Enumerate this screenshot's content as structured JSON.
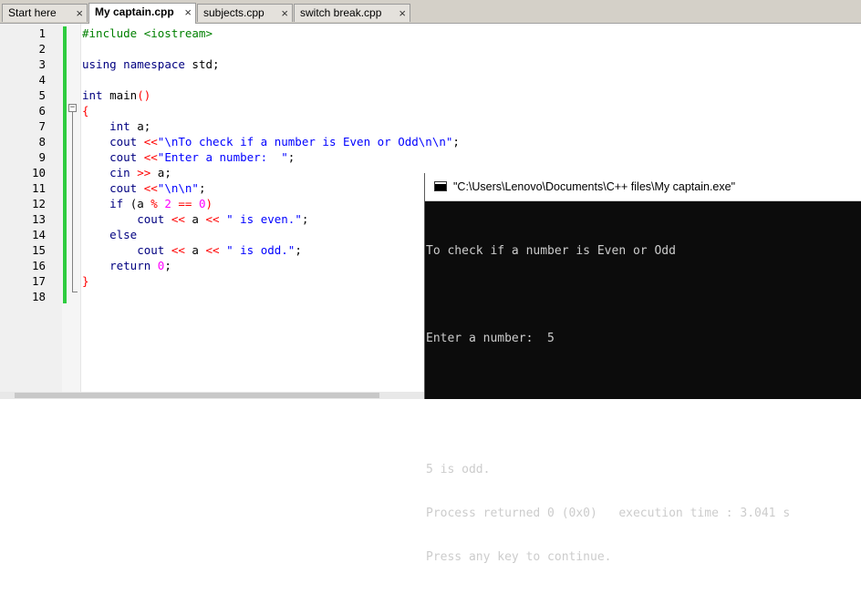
{
  "tabs": [
    {
      "label": "Start here",
      "close": "×"
    },
    {
      "label": "My captain.cpp",
      "close": "×",
      "active": true
    },
    {
      "label": "subjects.cpp",
      "close": "×"
    },
    {
      "label": "switch break.cpp",
      "close": "×"
    }
  ],
  "editor": {
    "line_numbers": [
      "1",
      "2",
      "3",
      "4",
      "5",
      "6",
      "7",
      "8",
      "9",
      "10",
      "11",
      "12",
      "13",
      "14",
      "15",
      "16",
      "17",
      "18"
    ],
    "fold_toggle": "−",
    "code": {
      "l1": {
        "pp": "#include <iostream>"
      },
      "l3": {
        "kw1": "using",
        "kw2": "namespace",
        "id": " std;"
      },
      "l5": {
        "kw": "int",
        "id": " main",
        "op": "()"
      },
      "l6": {
        "op": "{"
      },
      "l7": {
        "kw": "int",
        "id": " a;"
      },
      "l8": {
        "kw": "cout",
        "op": " <<",
        "str": "\"\\nTo check if a number is Even or Odd\\n\\n\"",
        "id": ";"
      },
      "l9": {
        "kw": "cout",
        "op": " <<",
        "str": "\"Enter a number:  \"",
        "id": ";"
      },
      "l10": {
        "kw": "cin",
        "op": " >>",
        "id": " a;"
      },
      "l11": {
        "kw": "cout",
        "op": " <<",
        "str": "\"\\n\\n\"",
        "id": ";"
      },
      "l12": {
        "kw": "if",
        "p1": " (a ",
        "op1": "%",
        "num1": " 2",
        "op2": " ==",
        "num2": " 0",
        "op3": ")"
      },
      "l13": {
        "kw": "cout",
        "op1": " <<",
        "id1": " a ",
        "op2": "<<",
        "str": " \" is even.\"",
        "id2": ";"
      },
      "l14": {
        "kw": "else"
      },
      "l15": {
        "kw": "cout",
        "op1": " <<",
        "id1": " a ",
        "op2": "<<",
        "str": " \" is odd.\"",
        "id2": ";"
      },
      "l16": {
        "kw": "return",
        "num": " 0",
        "id": ";"
      },
      "l17": {
        "op": "}"
      }
    }
  },
  "console": {
    "title": "\"C:\\Users\\Lenovo\\Documents\\C++ files\\My captain.exe\"",
    "lines": [
      "To check if a number is Even or Odd",
      "",
      "Enter a number:  5",
      "",
      "",
      "5 is odd.",
      "Process returned 0 (0x0)   execution time : 3.041 s",
      "Press any key to continue."
    ]
  },
  "colors": {
    "preprocessor": "#008000",
    "keyword": "#000080",
    "operator": "#ff0000",
    "string": "#0000ff",
    "number": "#ff00ff",
    "change_bar": "#2ecc40",
    "console_bg": "#0c0c0c"
  }
}
